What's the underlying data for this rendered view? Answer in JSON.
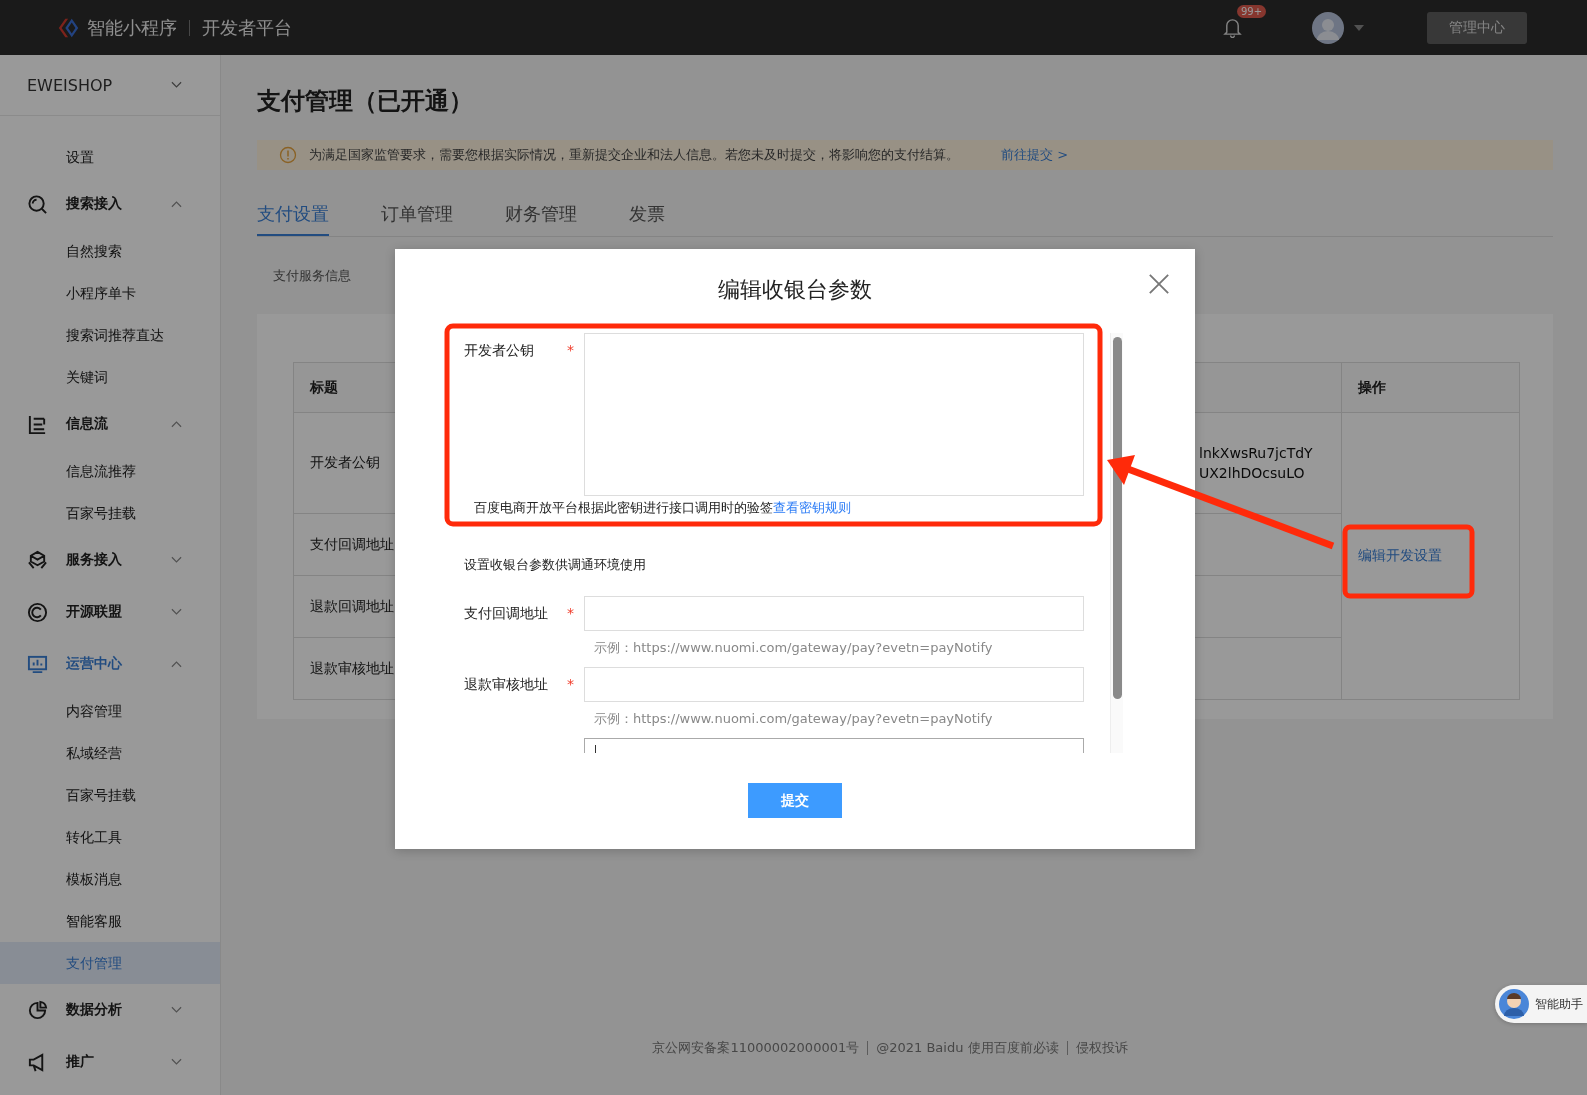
{
  "header": {
    "product": "智能小程序",
    "platform": "开发者平台",
    "badge": "99+",
    "admin_button": "管理中心"
  },
  "sidebar": {
    "account": "EWEISHOP",
    "items": [
      {
        "kind": "item",
        "label": "设置",
        "selected": false
      },
      {
        "kind": "group",
        "label": "搜索接入",
        "expanded": true,
        "active": false,
        "children": [
          {
            "label": "自然搜索",
            "selected": false
          },
          {
            "label": "小程序单卡",
            "selected": false
          },
          {
            "label": "搜索词推荐直达",
            "selected": false
          },
          {
            "label": "关键词",
            "selected": false
          }
        ]
      },
      {
        "kind": "group",
        "label": "信息流",
        "expanded": true,
        "active": false,
        "children": [
          {
            "label": "信息流推荐",
            "selected": false
          },
          {
            "label": "百家号挂载",
            "selected": false
          }
        ]
      },
      {
        "kind": "group",
        "label": "服务接入",
        "expanded": false,
        "active": false
      },
      {
        "kind": "group",
        "label": "开源联盟",
        "expanded": false,
        "active": false
      },
      {
        "kind": "group",
        "label": "运营中心",
        "expanded": true,
        "active": true,
        "children": [
          {
            "label": "内容管理",
            "selected": false
          },
          {
            "label": "私域经营",
            "selected": false
          },
          {
            "label": "百家号挂载",
            "selected": false
          },
          {
            "label": "转化工具",
            "selected": false
          },
          {
            "label": "模板消息",
            "selected": false
          },
          {
            "label": "智能客服",
            "selected": false
          },
          {
            "label": "支付管理",
            "selected": true
          }
        ]
      },
      {
        "kind": "group",
        "label": "数据分析",
        "expanded": false,
        "active": false
      },
      {
        "kind": "group",
        "label": "推广",
        "expanded": false,
        "active": false
      }
    ]
  },
  "main": {
    "title": "支付管理（已开通）",
    "notice": {
      "text": "为满足国家监管要求，需要您根据实际情况，重新提交企业和法人信息。若您未及时提交，将影响您的支付结算。",
      "link": "前往提交 >"
    },
    "tabs": [
      {
        "label": "支付设置",
        "selected": true
      },
      {
        "label": "订单管理",
        "selected": false
      },
      {
        "label": "财务管理",
        "selected": false
      },
      {
        "label": "发票",
        "selected": false
      }
    ],
    "subtab": "支付服务信息",
    "table": {
      "columns": [
        "标题",
        "操作"
      ],
      "action": "编辑开发设置",
      "rows": [
        {
          "title": "开发者公钥",
          "value_lines": [
            "lnkXwsRu7jcTdY",
            "UX2lhDOcsuLO"
          ]
        },
        {
          "title": "支付回调地址"
        },
        {
          "title": "退款回调地址"
        },
        {
          "title": "退款审核地址"
        }
      ]
    }
  },
  "dialog": {
    "title": "编辑收银台参数",
    "fields": [
      {
        "kind": "textarea",
        "label": "开发者公钥",
        "required": true,
        "required_mark": "*",
        "hint": "百度电商开放平台根据此密钥进行接口调用时的验签",
        "hint_link": "查看密钥规则"
      },
      {
        "kind": "section",
        "text": "设置收银台参数供调通环境使用"
      },
      {
        "kind": "input",
        "label": "支付回调地址",
        "required": true,
        "required_mark": "*",
        "example": "示例：https://www.nuomi.com/gateway/pay?evetn=payNotify"
      },
      {
        "kind": "input",
        "label": "退款审核地址",
        "required": true,
        "required_mark": "*",
        "example": "示例：https://www.nuomi.com/gateway/pay?evetn=payNotify"
      },
      {
        "kind": "input"
      }
    ],
    "submit": "提交"
  },
  "footer": [
    "京公网安备案11000002000001号",
    "@2021 Baidu 使用百度前必读",
    "侵权投诉"
  ],
  "assistant": "智能助手"
}
